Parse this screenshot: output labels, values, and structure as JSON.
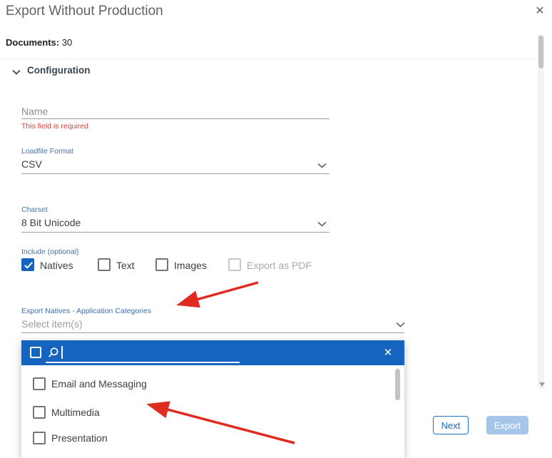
{
  "modal": {
    "title": "Export Without Production"
  },
  "icons": {
    "close": "✕",
    "dropdown_close": "✕"
  },
  "summary": {
    "documents_label": "Documents:",
    "documents_count": "30"
  },
  "configuration": {
    "header": "Configuration"
  },
  "form": {
    "name": {
      "label": "Name",
      "value": "",
      "error": "This field is required"
    },
    "loadfile_format": {
      "label": "Loadfile Format",
      "value": "CSV"
    },
    "charset": {
      "label": "Charset",
      "value": "8 Bit Unicode"
    },
    "include": {
      "label": "Include (optional)",
      "options": [
        {
          "label": "Natives",
          "checked": true,
          "disabled": false
        },
        {
          "label": "Text",
          "checked": false,
          "disabled": false
        },
        {
          "label": "Images",
          "checked": false,
          "disabled": false
        },
        {
          "label": "Export as PDF",
          "checked": false,
          "disabled": true
        }
      ]
    },
    "export_natives": {
      "label": "Export Natives - Application Categories",
      "placeholder": "Select item(s)"
    }
  },
  "dropdown": {
    "search_value": "",
    "items": [
      {
        "label": "Email and Messaging",
        "checked": false
      },
      {
        "label": "Multimedia",
        "checked": false
      },
      {
        "label": "Presentation",
        "checked": false
      }
    ]
  },
  "footer": {
    "next_label": "Next",
    "export_label": "Export"
  },
  "colors": {
    "accent_blue": "#1565c0",
    "error_red": "#e5392f",
    "disabled_button_bg": "#a5c6e9",
    "annotation_arrow_red": "#e02b20"
  }
}
